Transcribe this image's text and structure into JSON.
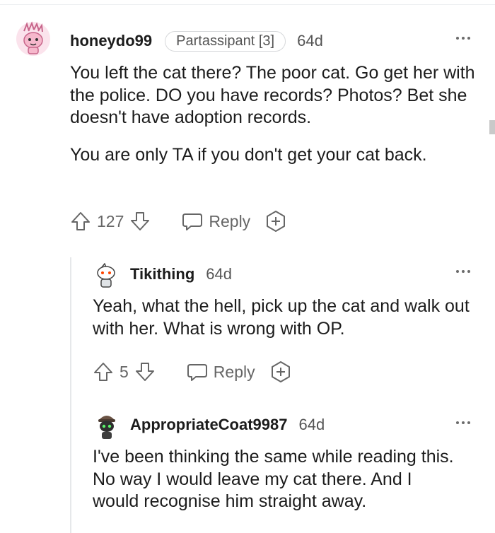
{
  "comments": [
    {
      "username": "honeydo99",
      "flair": "Partassipant [3]",
      "age": "64d",
      "paragraphs": [
        "You left the cat there? The poor cat. Go get her with the police. DO you have records? Photos? Bet she doesn't have adoption records.",
        "You are only TA if you don't get your cat back."
      ],
      "score": "127",
      "reply_label": "Reply"
    },
    {
      "username": "Tikithing",
      "age": "64d",
      "paragraphs": [
        "Yeah, what the hell, pick up the cat and walk out with her. What is wrong with OP."
      ],
      "score": "5",
      "reply_label": "Reply"
    },
    {
      "username": "AppropriateCoat9987",
      "age": "64d",
      "paragraphs": [
        "I've been thinking the same while reading this. No way I would leave my cat there. And I would recognise him straight away."
      ]
    }
  ],
  "icons": {
    "upvote": "arrow-up-outline",
    "downvote": "arrow-down-outline",
    "reply": "chat-bubble-outline",
    "award": "plus-in-circle",
    "more": "three-dots"
  },
  "colors": {
    "text": "#1c1c1c",
    "muted": "#666666",
    "thread_line": "#e6e8ea"
  }
}
